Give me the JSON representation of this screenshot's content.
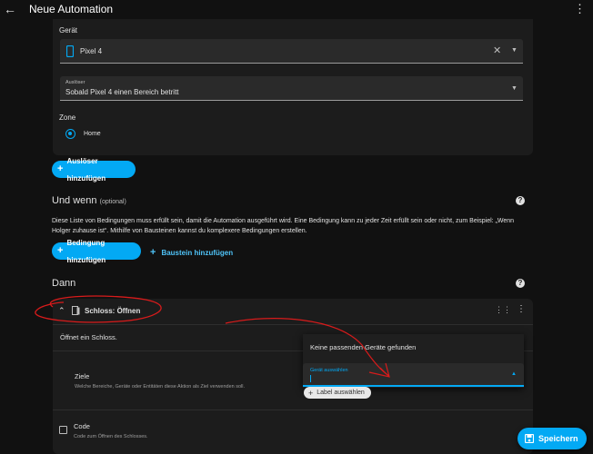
{
  "header": {
    "title": "Neue Automation"
  },
  "trigger": {
    "device_label": "Gerät",
    "device_value": "Pixel 4",
    "trigger_label": "Auslöser",
    "trigger_value": "Sobald Pixel 4 einen Bereich betritt",
    "zone_label": "Zone",
    "zone_option": "Home",
    "add_trigger": "Auslöser hinzufügen"
  },
  "conditions": {
    "title": "Und wenn",
    "optional": "(optional)",
    "description": "Diese Liste von Bedingungen muss erfüllt sein, damit die Automation ausgeführt wird. Eine Bedingung kann zu jeder Zeit erfüllt sein oder nicht, zum Beispiel: „Wenn Holger zuhause ist“. Mithilfe von Bausteinen kannst du komplexere Bedingungen erstellen.",
    "add_condition": "Bedingung hinzufügen",
    "add_block": "Baustein hinzufügen"
  },
  "actions": {
    "title": "Dann",
    "action_title": "Schloss: Öffnen",
    "action_description": "Öffnet ein Schloss.",
    "targets_label": "Ziele",
    "targets_help": "Welche Bereiche, Geräte oder Entitäten diese Aktion als Ziel verwenden soll.",
    "code_label": "Code",
    "code_help": "Code zum Öffnen des Schlosses."
  },
  "dropdown": {
    "no_devices": "Keine passenden Geräte gefunden",
    "select_device_label": "Gerät auswählen"
  },
  "chip": {
    "label": "Label auswählen"
  },
  "save_button": {
    "label": "Speichern"
  },
  "colors": {
    "accent": "#03a9f4",
    "background": "#111111",
    "card": "#1c1c1c",
    "annotation": "#d81b1b"
  }
}
